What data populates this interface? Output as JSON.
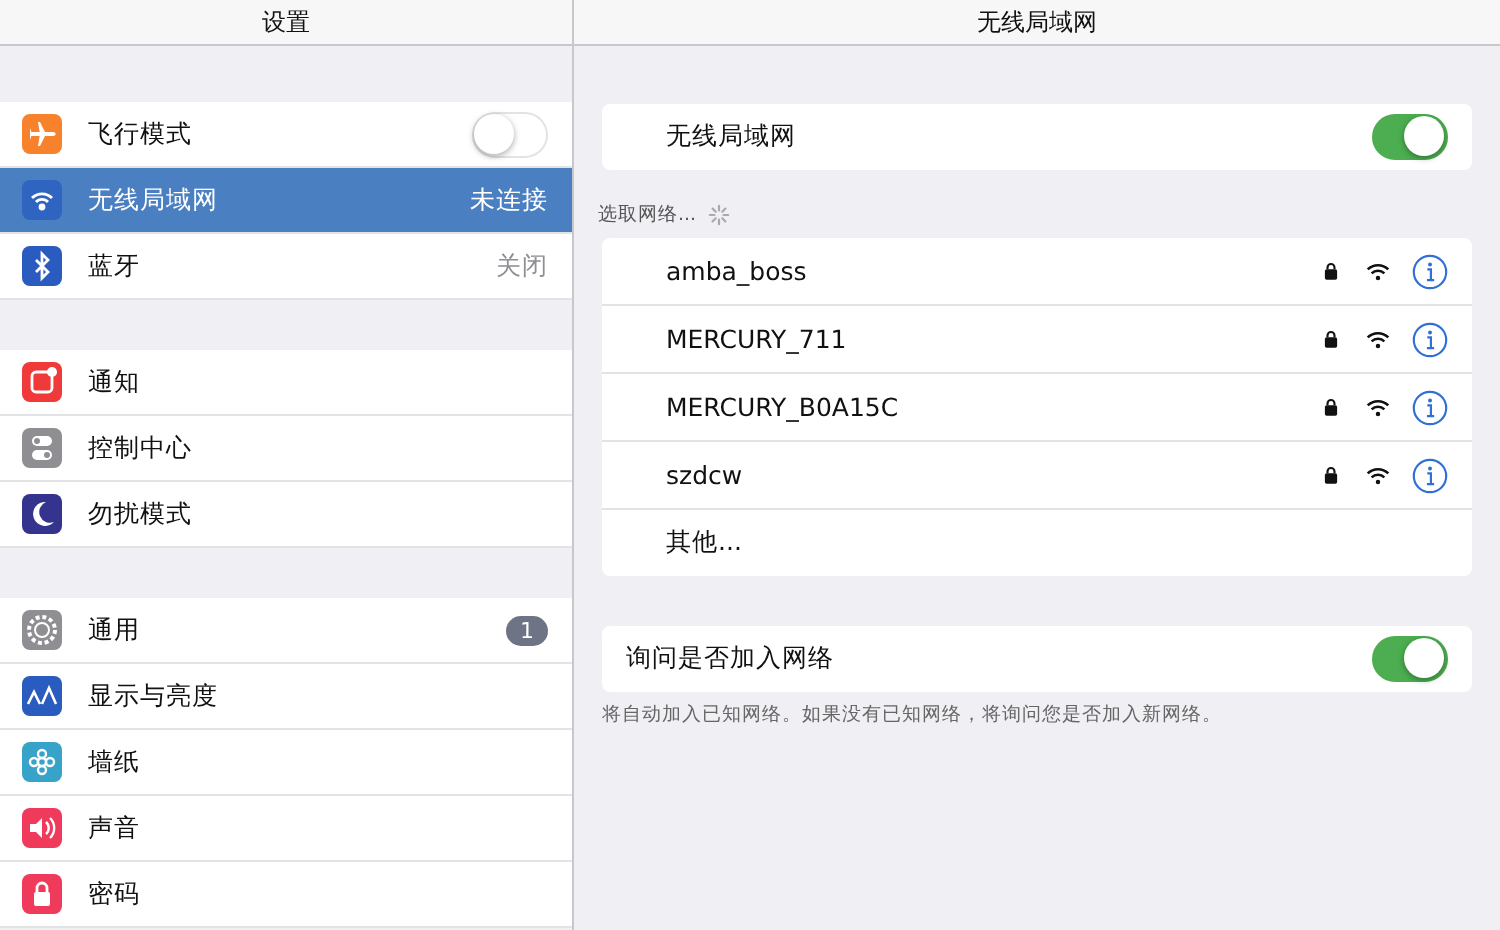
{
  "sidebar": {
    "title": "设置",
    "groups": [
      [
        {
          "label": "飞行模式",
          "kind": "toggle",
          "on": false,
          "selected": false
        },
        {
          "label": "无线局域网",
          "kind": "detail",
          "value": "未连接",
          "selected": true
        },
        {
          "label": "蓝牙",
          "kind": "detail",
          "value": "关闭",
          "selected": false
        }
      ],
      [
        {
          "label": "通知",
          "kind": "plain",
          "selected": false
        },
        {
          "label": "控制中心",
          "kind": "plain",
          "selected": false
        },
        {
          "label": "勿扰模式",
          "kind": "plain",
          "selected": false
        }
      ],
      [
        {
          "label": "通用",
          "kind": "badge",
          "badge": "1",
          "selected": false
        },
        {
          "label": "显示与亮度",
          "kind": "plain",
          "selected": false
        },
        {
          "label": "墙纸",
          "kind": "plain",
          "selected": false
        },
        {
          "label": "声音",
          "kind": "plain",
          "selected": false
        },
        {
          "label": "密码",
          "kind": "plain",
          "selected": false
        }
      ]
    ]
  },
  "detail": {
    "title": "无线局域网",
    "wifi": {
      "label": "无线局域网",
      "on": true
    },
    "networks_header": "选取网络...",
    "networks": [
      {
        "name": "amba_boss",
        "kind": "network",
        "locked": true
      },
      {
        "name": "MERCURY_711",
        "kind": "network",
        "locked": true
      },
      {
        "name": "MERCURY_B0A15C",
        "kind": "network",
        "locked": true
      },
      {
        "name": "szdcw",
        "kind": "network",
        "locked": true
      },
      {
        "name": "其他...",
        "kind": "other"
      }
    ],
    "ask": {
      "label": "询问是否加入网络",
      "on": true
    },
    "footnote": "将自动加入已知网络。如果没有已知网络，将询问您是否加入新网络。"
  }
}
